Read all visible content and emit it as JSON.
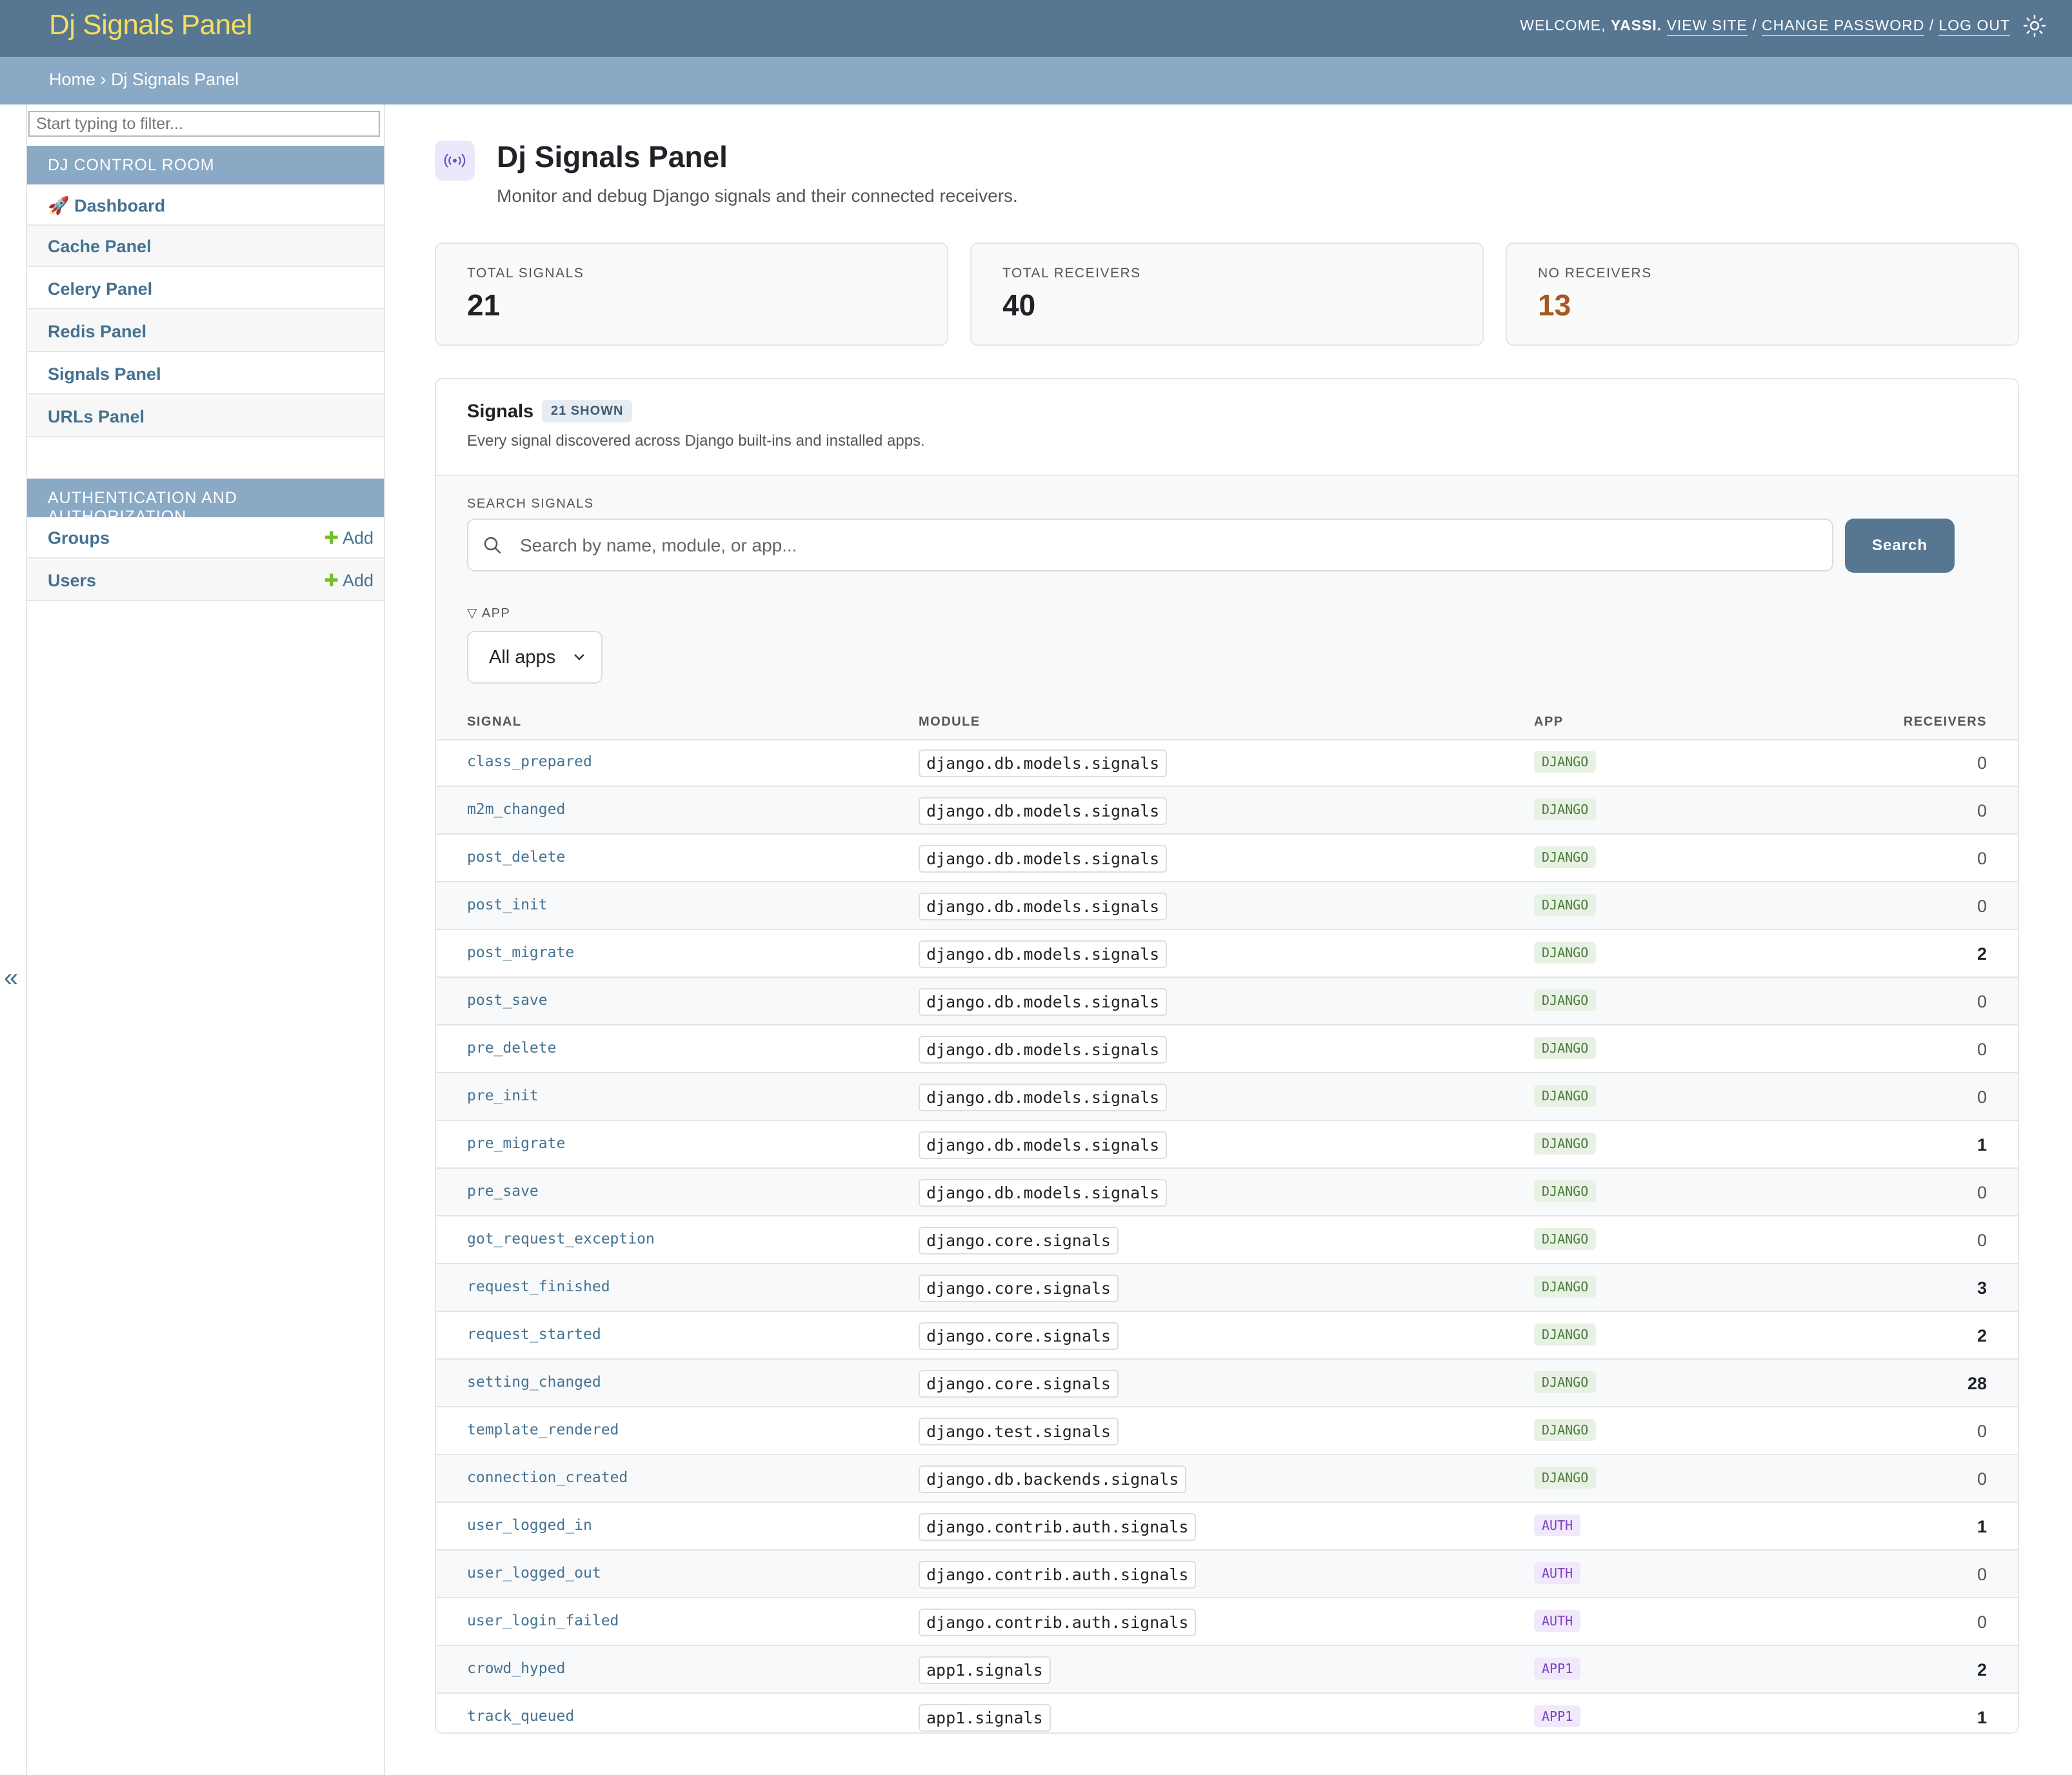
{
  "header": {
    "site_title": "Dj Signals Panel",
    "welcome": "WELCOME,",
    "user": "YASSI.",
    "view_site": "VIEW SITE",
    "change_password": "CHANGE PASSWORD",
    "log_out": "LOG OUT",
    "sep": "/"
  },
  "breadcrumb": {
    "home": "Home",
    "sep": "›",
    "current": "Dj Signals Panel"
  },
  "sidebar": {
    "filter_placeholder": "Start typing to filter...",
    "modules": [
      {
        "caption": "DJ CONTROL ROOM",
        "items": [
          {
            "label": "🚀 Dashboard"
          },
          {
            "label": "Cache Panel"
          },
          {
            "label": "Celery Panel"
          },
          {
            "label": "Redis Panel"
          },
          {
            "label": "Signals Panel"
          },
          {
            "label": "URLs Panel"
          }
        ]
      },
      {
        "caption": "AUTHENTICATION AND AUTHORIZATION",
        "items": [
          {
            "label": "Groups",
            "add": "Add"
          },
          {
            "label": "Users",
            "add": "Add"
          }
        ]
      }
    ],
    "collapse_glyph": "«"
  },
  "main": {
    "title": "Dj Signals Panel",
    "subtitle": "Monitor and debug Django signals and their connected receivers.",
    "title_icon": "broadcast-icon",
    "stats": [
      {
        "label": "TOTAL SIGNALS",
        "value": "21"
      },
      {
        "label": "TOTAL RECEIVERS",
        "value": "40"
      },
      {
        "label": "NO RECEIVERS",
        "value": "13"
      }
    ],
    "panel": {
      "title": "Signals",
      "count_badge": "21 SHOWN",
      "description": "Every signal discovered across Django built-ins and installed apps.",
      "search_label": "SEARCH SIGNALS",
      "search_placeholder": "Search by name, module, or app...",
      "search_button": "Search",
      "app_filter_label": "APP",
      "app_filter_value": "All apps"
    },
    "table": {
      "columns": [
        "SIGNAL",
        "MODULE",
        "APP",
        "RECEIVERS"
      ],
      "rows": [
        {
          "signal": "class_prepared",
          "module": "django.db.models.signals",
          "app": "DJANGO",
          "receivers": "0"
        },
        {
          "signal": "m2m_changed",
          "module": "django.db.models.signals",
          "app": "DJANGO",
          "receivers": "0"
        },
        {
          "signal": "post_delete",
          "module": "django.db.models.signals",
          "app": "DJANGO",
          "receivers": "0"
        },
        {
          "signal": "post_init",
          "module": "django.db.models.signals",
          "app": "DJANGO",
          "receivers": "0"
        },
        {
          "signal": "post_migrate",
          "module": "django.db.models.signals",
          "app": "DJANGO",
          "receivers": "2"
        },
        {
          "signal": "post_save",
          "module": "django.db.models.signals",
          "app": "DJANGO",
          "receivers": "0"
        },
        {
          "signal": "pre_delete",
          "module": "django.db.models.signals",
          "app": "DJANGO",
          "receivers": "0"
        },
        {
          "signal": "pre_init",
          "module": "django.db.models.signals",
          "app": "DJANGO",
          "receivers": "0"
        },
        {
          "signal": "pre_migrate",
          "module": "django.db.models.signals",
          "app": "DJANGO",
          "receivers": "1"
        },
        {
          "signal": "pre_save",
          "module": "django.db.models.signals",
          "app": "DJANGO",
          "receivers": "0"
        },
        {
          "signal": "got_request_exception",
          "module": "django.core.signals",
          "app": "DJANGO",
          "receivers": "0"
        },
        {
          "signal": "request_finished",
          "module": "django.core.signals",
          "app": "DJANGO",
          "receivers": "3"
        },
        {
          "signal": "request_started",
          "module": "django.core.signals",
          "app": "DJANGO",
          "receivers": "2"
        },
        {
          "signal": "setting_changed",
          "module": "django.core.signals",
          "app": "DJANGO",
          "receivers": "28"
        },
        {
          "signal": "template_rendered",
          "module": "django.test.signals",
          "app": "DJANGO",
          "receivers": "0"
        },
        {
          "signal": "connection_created",
          "module": "django.db.backends.signals",
          "app": "DJANGO",
          "receivers": "0"
        },
        {
          "signal": "user_logged_in",
          "module": "django.contrib.auth.signals",
          "app": "AUTH",
          "receivers": "1"
        },
        {
          "signal": "user_logged_out",
          "module": "django.contrib.auth.signals",
          "app": "AUTH",
          "receivers": "0"
        },
        {
          "signal": "user_login_failed",
          "module": "django.contrib.auth.signals",
          "app": "AUTH",
          "receivers": "0"
        },
        {
          "signal": "crowd_hyped",
          "module": "app1.signals",
          "app": "APP1",
          "receivers": "2"
        },
        {
          "signal": "track_queued",
          "module": "app1.signals",
          "app": "APP1",
          "receivers": "1"
        }
      ]
    }
  },
  "colors": {
    "header_bg": "#577692",
    "breadcrumb_bg": "#8aa9c5",
    "site_title": "#f5dd5d",
    "link": "#447291",
    "warn": "#a8581d",
    "add_plus": "#70bf2b"
  }
}
